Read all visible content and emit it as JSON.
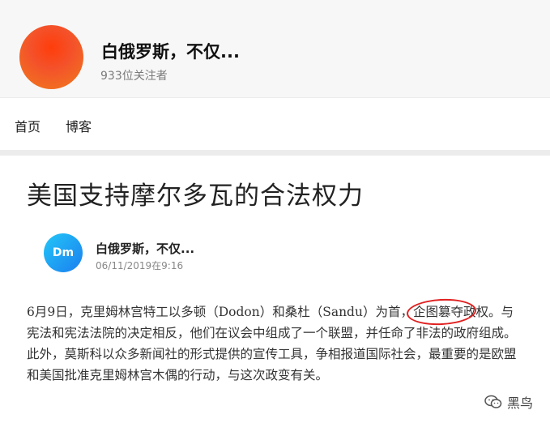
{
  "header": {
    "avatar_color": "#f4512a",
    "title": "白俄罗斯，不仅...",
    "followers": "933位关注者"
  },
  "nav": {
    "home": "首页",
    "blog": "博客"
  },
  "article": {
    "title": "美国支持摩尔多瓦的合法权力",
    "author": {
      "initials": "Dm",
      "name": "白俄罗斯，不仅...",
      "date": "06/11/2019在9:16"
    },
    "body_before": "6月9日，克里姆林宫特工以多顿（Dodon）和桑杜（Sandu）为首，",
    "body_highlight": "企图篡夺",
    "body_after": "政权。与宪法和宪法法院的决定相反，他们在议会中组成了一个联盟，并任命了非法的政府组成。此外，莫斯科以众多新闻社的形式提供的宣传工具，争相报道国际社会，最重要的是欧盟和美国批准克里姆林宫木偶的行动，与这次政变有关。",
    "highlight_color": "#e02020"
  },
  "watermark": {
    "icon": "wechat-icon",
    "text": "黑鸟"
  }
}
